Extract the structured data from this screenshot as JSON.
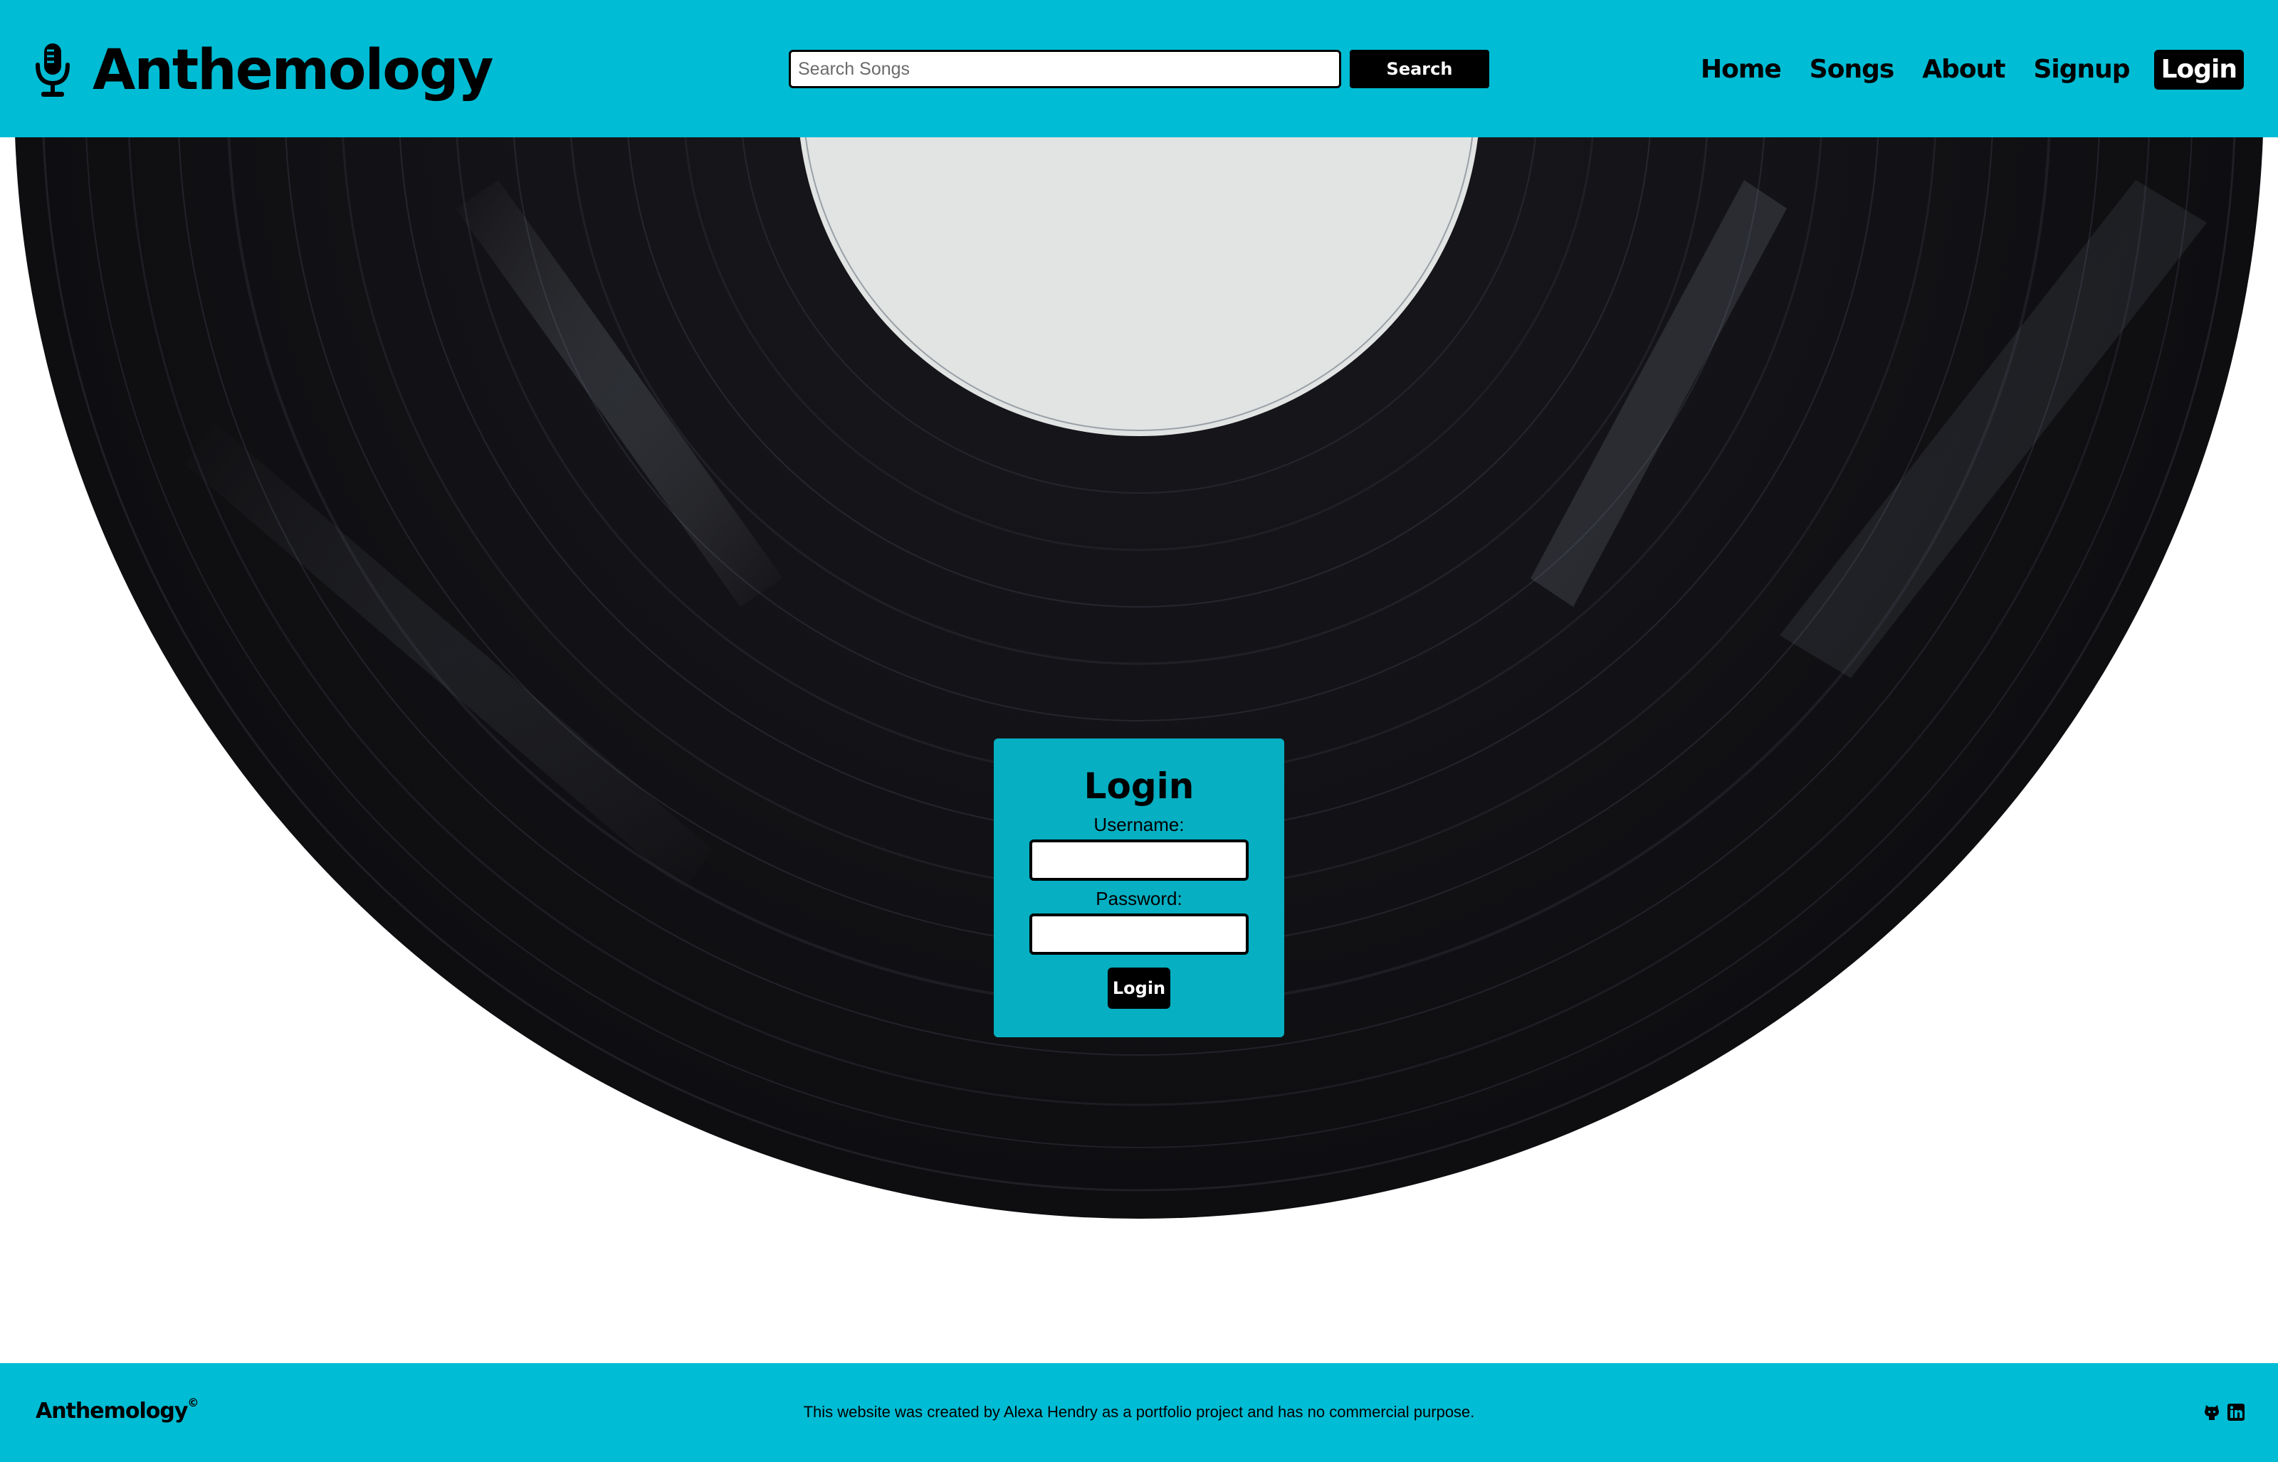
{
  "header": {
    "brand": "Anthemology",
    "brand_icon": "microphone-icon",
    "search": {
      "placeholder": "Search Songs",
      "value": "",
      "button_label": "Search"
    },
    "nav": {
      "home": "Home",
      "songs": "Songs",
      "about": "About",
      "signup": "Signup",
      "login": "Login",
      "active": "login"
    },
    "color": "#00bcd4"
  },
  "hero": {
    "background_image": "vinyl-record",
    "record_color": "#121214",
    "label_color": "#e1e4e3"
  },
  "login_form": {
    "title": "Login",
    "username_label": "Username:",
    "username_value": "",
    "password_label": "Password:",
    "password_value": "",
    "submit_label": "Login",
    "color": "#06afc2"
  },
  "footer": {
    "brand": "Anthemology",
    "copyright_symbol": "©",
    "text": "This website was created by Alexa Hendry as a portfolio project and has no commercial purpose.",
    "icons": [
      "github-icon",
      "linkedin-icon"
    ]
  }
}
